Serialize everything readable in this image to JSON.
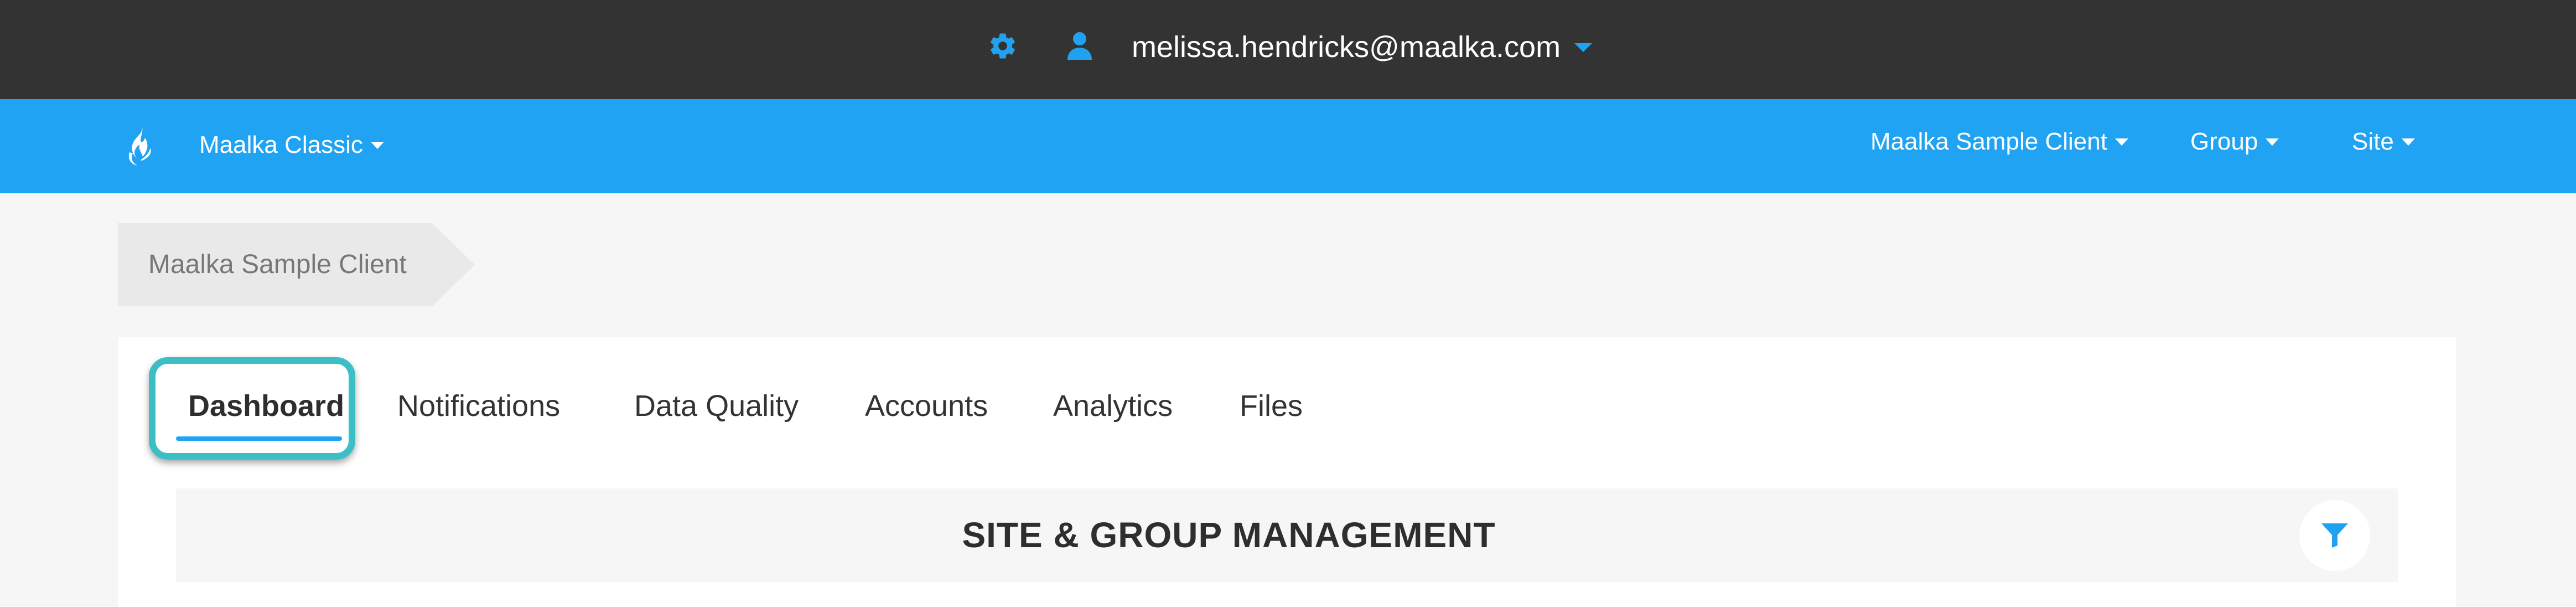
{
  "topbar": {
    "settings_icon": "gear-icon",
    "user_icon": "user-icon",
    "email": "melissa.hendricks@maalka.com",
    "email_caret_icon": "caret-down-icon",
    "accent_color": "#22a1f0"
  },
  "navbar": {
    "logo_icon": "flame-logo-icon",
    "app_switcher_label": "Maalka Classic",
    "client_label": "Maalka Sample Client",
    "group_label": "Group",
    "site_label": "Site",
    "background_color": "#21a3f3"
  },
  "breadcrumb": {
    "items": [
      "Maalka Sample Client"
    ]
  },
  "tabs": [
    {
      "label": "Dashboard",
      "active": true
    },
    {
      "label": "Notifications",
      "active": false
    },
    {
      "label": "Data Quality",
      "active": false
    },
    {
      "label": "Accounts",
      "active": false
    },
    {
      "label": "Analytics",
      "active": false
    },
    {
      "label": "Files",
      "active": false
    }
  ],
  "section": {
    "title": "SITE & GROUP MANAGEMENT",
    "filter_icon": "filter-icon"
  },
  "highlight_color": "#3bbfc4"
}
